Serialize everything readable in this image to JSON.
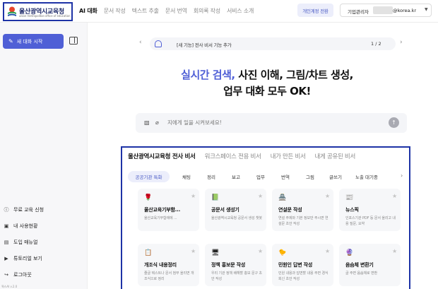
{
  "header": {
    "logo_title": "울산광역시교육청",
    "logo_subtitle": "ulsan metropolitan office of education",
    "nav": [
      "AI 대화",
      "문서 작성",
      "텍스트 추출",
      "문서 번역",
      "회의록 작성",
      "서비스 소개"
    ],
    "personal_button": "개인계정 전환",
    "account_label": "기업관리자",
    "account_email": "@korea.kr",
    "brand_color": "#1e33a6",
    "accent_color": "#4f5fd6"
  },
  "sidebar": {
    "new_chat": "새 대화 시작",
    "new_chat_icon": "pencil-icon",
    "menu": [
      {
        "icon": "info-icon",
        "label": "무료 교육 신청"
      },
      {
        "icon": "user-icon",
        "label": "내 사용현황"
      },
      {
        "icon": "book-icon",
        "label": "도입 매뉴얼"
      },
      {
        "icon": "video-icon",
        "label": "튜토리얼 보기"
      },
      {
        "icon": "logout-icon",
        "label": "로그아웃"
      }
    ],
    "footer": "웍스AI v.2.0"
  },
  "banner": {
    "text": "[새 기능] 전사 비서 기능 추가",
    "page": "1 / 2"
  },
  "hero": {
    "accent": "실시간 검색,",
    "line1_rest": " 사진 이해, 그림/차트 생성,",
    "line2": "업무 대화 모두 OK!"
  },
  "prompt": {
    "placeholder": "지에게 일을 시켜보세요!"
  },
  "assistants": {
    "tabs": [
      "울산광역시교육청 전사 비서",
      "워크스페이스 전용 비서",
      "내가 만든 비서",
      "내게 공유된 비서"
    ],
    "chips": [
      "공공기관 특화",
      "채팅",
      "정리",
      "보고",
      "업무",
      "번역",
      "그림",
      "글쓰기",
      "노출 대기중"
    ],
    "cards": [
      {
        "icon": "🌹",
        "title": "울산교육기부함...",
        "desc": "울산교육기부함에에 ..."
      },
      {
        "icon": "📗",
        "title": "공문서 생성기",
        "desc": "울산광역시교육청 공문서 생성 챗봇"
      },
      {
        "icon": "🏯",
        "title": "연설문 작성",
        "desc": "연설 주제와 기본 정보만 주시면 연설문 초안 작성"
      },
      {
        "icon": "📰",
        "title": "뉴스픽",
        "desc": "인포스기관 PDF 등 문서 올리고 내용 질문, 요약"
      },
      {
        "icon": "📋",
        "title": "개조식 내용정리",
        "desc": "줄글 텍스트나 문서 첨부 올리면 개조식으로 정리"
      },
      {
        "icon": "🖥",
        "title": "정책 홍보문 작성",
        "desc": "우리 기관 정책 배해할 홍보 문구 초안 작성"
      },
      {
        "icon": "🐤",
        "title": "민원인 답변 작성",
        "desc": "민원 내용과 답변할 내용 주면 경식 회신 초안 작성"
      },
      {
        "icon": "🔮",
        "title": "음슴체 변환기",
        "desc": "글 주면 음슴체로 변환"
      }
    ]
  }
}
